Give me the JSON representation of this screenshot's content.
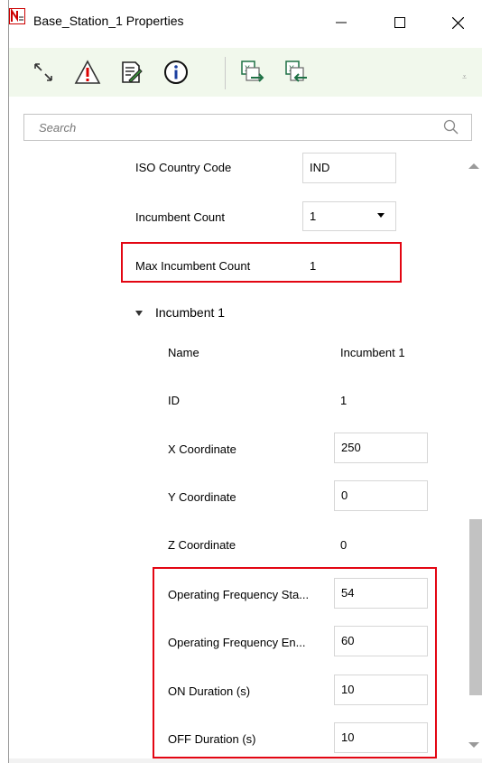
{
  "window": {
    "title": "Base_Station_1 Properties",
    "minimize_label": "—",
    "maximize_label": "☐",
    "close_label": "✕",
    "accent_color": "#e30613"
  },
  "toolbar": {
    "icons": [
      "resize-icon",
      "warning-icon",
      "edit-document-icon",
      "info-icon",
      "excel-export-icon",
      "excel-import-icon"
    ]
  },
  "search": {
    "placeholder": "Search"
  },
  "properties": {
    "iso_country_code": {
      "label": "ISO Country Code",
      "value": "IND"
    },
    "incumbent_count": {
      "label": "Incumbent Count",
      "value": "1"
    },
    "max_incumbent_count": {
      "label": "Max Incumbent Count",
      "value": "1"
    }
  },
  "incumbent_group": {
    "title": "Incumbent 1",
    "rows": {
      "name": {
        "label": "Name",
        "value": "Incumbent 1"
      },
      "id": {
        "label": "ID",
        "value": "1"
      },
      "x": {
        "label": "X Coordinate",
        "value": "250"
      },
      "y": {
        "label": "Y Coordinate",
        "value": "0"
      },
      "z": {
        "label": "Z Coordinate",
        "value": "0"
      },
      "freq_start": {
        "label": "Operating Frequency Sta...",
        "value": "54"
      },
      "freq_end": {
        "label": "Operating Frequency En...",
        "value": "60"
      },
      "on_duration": {
        "label": "ON Duration (s)",
        "value": "10"
      },
      "off_duration": {
        "label": "OFF Duration (s)",
        "value": "10"
      }
    }
  }
}
